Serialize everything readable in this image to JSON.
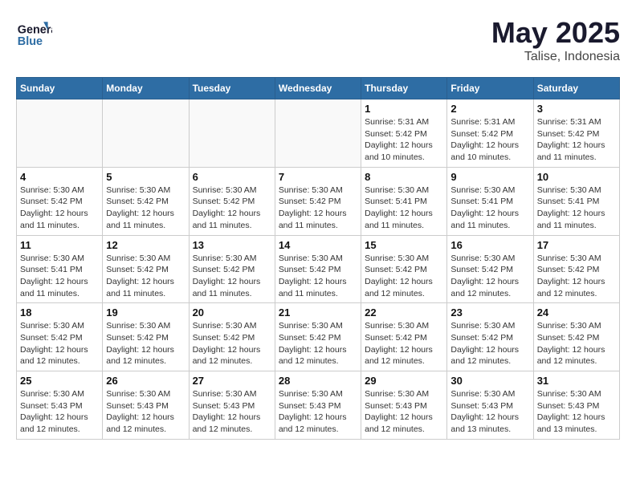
{
  "header": {
    "logo_line1": "General",
    "logo_line2": "Blue",
    "month": "May 2025",
    "location": "Talise, Indonesia"
  },
  "days_of_week": [
    "Sunday",
    "Monday",
    "Tuesday",
    "Wednesday",
    "Thursday",
    "Friday",
    "Saturday"
  ],
  "weeks": [
    [
      {
        "day": "",
        "sunrise": "",
        "sunset": "",
        "daylight": ""
      },
      {
        "day": "",
        "sunrise": "",
        "sunset": "",
        "daylight": ""
      },
      {
        "day": "",
        "sunrise": "",
        "sunset": "",
        "daylight": ""
      },
      {
        "day": "",
        "sunrise": "",
        "sunset": "",
        "daylight": ""
      },
      {
        "day": "1",
        "sunrise": "Sunrise: 5:31 AM",
        "sunset": "Sunset: 5:42 PM",
        "daylight": "Daylight: 12 hours and 10 minutes."
      },
      {
        "day": "2",
        "sunrise": "Sunrise: 5:31 AM",
        "sunset": "Sunset: 5:42 PM",
        "daylight": "Daylight: 12 hours and 10 minutes."
      },
      {
        "day": "3",
        "sunrise": "Sunrise: 5:31 AM",
        "sunset": "Sunset: 5:42 PM",
        "daylight": "Daylight: 12 hours and 11 minutes."
      }
    ],
    [
      {
        "day": "4",
        "sunrise": "Sunrise: 5:30 AM",
        "sunset": "Sunset: 5:42 PM",
        "daylight": "Daylight: 12 hours and 11 minutes."
      },
      {
        "day": "5",
        "sunrise": "Sunrise: 5:30 AM",
        "sunset": "Sunset: 5:42 PM",
        "daylight": "Daylight: 12 hours and 11 minutes."
      },
      {
        "day": "6",
        "sunrise": "Sunrise: 5:30 AM",
        "sunset": "Sunset: 5:42 PM",
        "daylight": "Daylight: 12 hours and 11 minutes."
      },
      {
        "day": "7",
        "sunrise": "Sunrise: 5:30 AM",
        "sunset": "Sunset: 5:42 PM",
        "daylight": "Daylight: 12 hours and 11 minutes."
      },
      {
        "day": "8",
        "sunrise": "Sunrise: 5:30 AM",
        "sunset": "Sunset: 5:41 PM",
        "daylight": "Daylight: 12 hours and 11 minutes."
      },
      {
        "day": "9",
        "sunrise": "Sunrise: 5:30 AM",
        "sunset": "Sunset: 5:41 PM",
        "daylight": "Daylight: 12 hours and 11 minutes."
      },
      {
        "day": "10",
        "sunrise": "Sunrise: 5:30 AM",
        "sunset": "Sunset: 5:41 PM",
        "daylight": "Daylight: 12 hours and 11 minutes."
      }
    ],
    [
      {
        "day": "11",
        "sunrise": "Sunrise: 5:30 AM",
        "sunset": "Sunset: 5:41 PM",
        "daylight": "Daylight: 12 hours and 11 minutes."
      },
      {
        "day": "12",
        "sunrise": "Sunrise: 5:30 AM",
        "sunset": "Sunset: 5:42 PM",
        "daylight": "Daylight: 12 hours and 11 minutes."
      },
      {
        "day": "13",
        "sunrise": "Sunrise: 5:30 AM",
        "sunset": "Sunset: 5:42 PM",
        "daylight": "Daylight: 12 hours and 11 minutes."
      },
      {
        "day": "14",
        "sunrise": "Sunrise: 5:30 AM",
        "sunset": "Sunset: 5:42 PM",
        "daylight": "Daylight: 12 hours and 11 minutes."
      },
      {
        "day": "15",
        "sunrise": "Sunrise: 5:30 AM",
        "sunset": "Sunset: 5:42 PM",
        "daylight": "Daylight: 12 hours and 12 minutes."
      },
      {
        "day": "16",
        "sunrise": "Sunrise: 5:30 AM",
        "sunset": "Sunset: 5:42 PM",
        "daylight": "Daylight: 12 hours and 12 minutes."
      },
      {
        "day": "17",
        "sunrise": "Sunrise: 5:30 AM",
        "sunset": "Sunset: 5:42 PM",
        "daylight": "Daylight: 12 hours and 12 minutes."
      }
    ],
    [
      {
        "day": "18",
        "sunrise": "Sunrise: 5:30 AM",
        "sunset": "Sunset: 5:42 PM",
        "daylight": "Daylight: 12 hours and 12 minutes."
      },
      {
        "day": "19",
        "sunrise": "Sunrise: 5:30 AM",
        "sunset": "Sunset: 5:42 PM",
        "daylight": "Daylight: 12 hours and 12 minutes."
      },
      {
        "day": "20",
        "sunrise": "Sunrise: 5:30 AM",
        "sunset": "Sunset: 5:42 PM",
        "daylight": "Daylight: 12 hours and 12 minutes."
      },
      {
        "day": "21",
        "sunrise": "Sunrise: 5:30 AM",
        "sunset": "Sunset: 5:42 PM",
        "daylight": "Daylight: 12 hours and 12 minutes."
      },
      {
        "day": "22",
        "sunrise": "Sunrise: 5:30 AM",
        "sunset": "Sunset: 5:42 PM",
        "daylight": "Daylight: 12 hours and 12 minutes."
      },
      {
        "day": "23",
        "sunrise": "Sunrise: 5:30 AM",
        "sunset": "Sunset: 5:42 PM",
        "daylight": "Daylight: 12 hours and 12 minutes."
      },
      {
        "day": "24",
        "sunrise": "Sunrise: 5:30 AM",
        "sunset": "Sunset: 5:42 PM",
        "daylight": "Daylight: 12 hours and 12 minutes."
      }
    ],
    [
      {
        "day": "25",
        "sunrise": "Sunrise: 5:30 AM",
        "sunset": "Sunset: 5:43 PM",
        "daylight": "Daylight: 12 hours and 12 minutes."
      },
      {
        "day": "26",
        "sunrise": "Sunrise: 5:30 AM",
        "sunset": "Sunset: 5:43 PM",
        "daylight": "Daylight: 12 hours and 12 minutes."
      },
      {
        "day": "27",
        "sunrise": "Sunrise: 5:30 AM",
        "sunset": "Sunset: 5:43 PM",
        "daylight": "Daylight: 12 hours and 12 minutes."
      },
      {
        "day": "28",
        "sunrise": "Sunrise: 5:30 AM",
        "sunset": "Sunset: 5:43 PM",
        "daylight": "Daylight: 12 hours and 12 minutes."
      },
      {
        "day": "29",
        "sunrise": "Sunrise: 5:30 AM",
        "sunset": "Sunset: 5:43 PM",
        "daylight": "Daylight: 12 hours and 12 minutes."
      },
      {
        "day": "30",
        "sunrise": "Sunrise: 5:30 AM",
        "sunset": "Sunset: 5:43 PM",
        "daylight": "Daylight: 12 hours and 13 minutes."
      },
      {
        "day": "31",
        "sunrise": "Sunrise: 5:30 AM",
        "sunset": "Sunset: 5:43 PM",
        "daylight": "Daylight: 12 hours and 13 minutes."
      }
    ]
  ]
}
